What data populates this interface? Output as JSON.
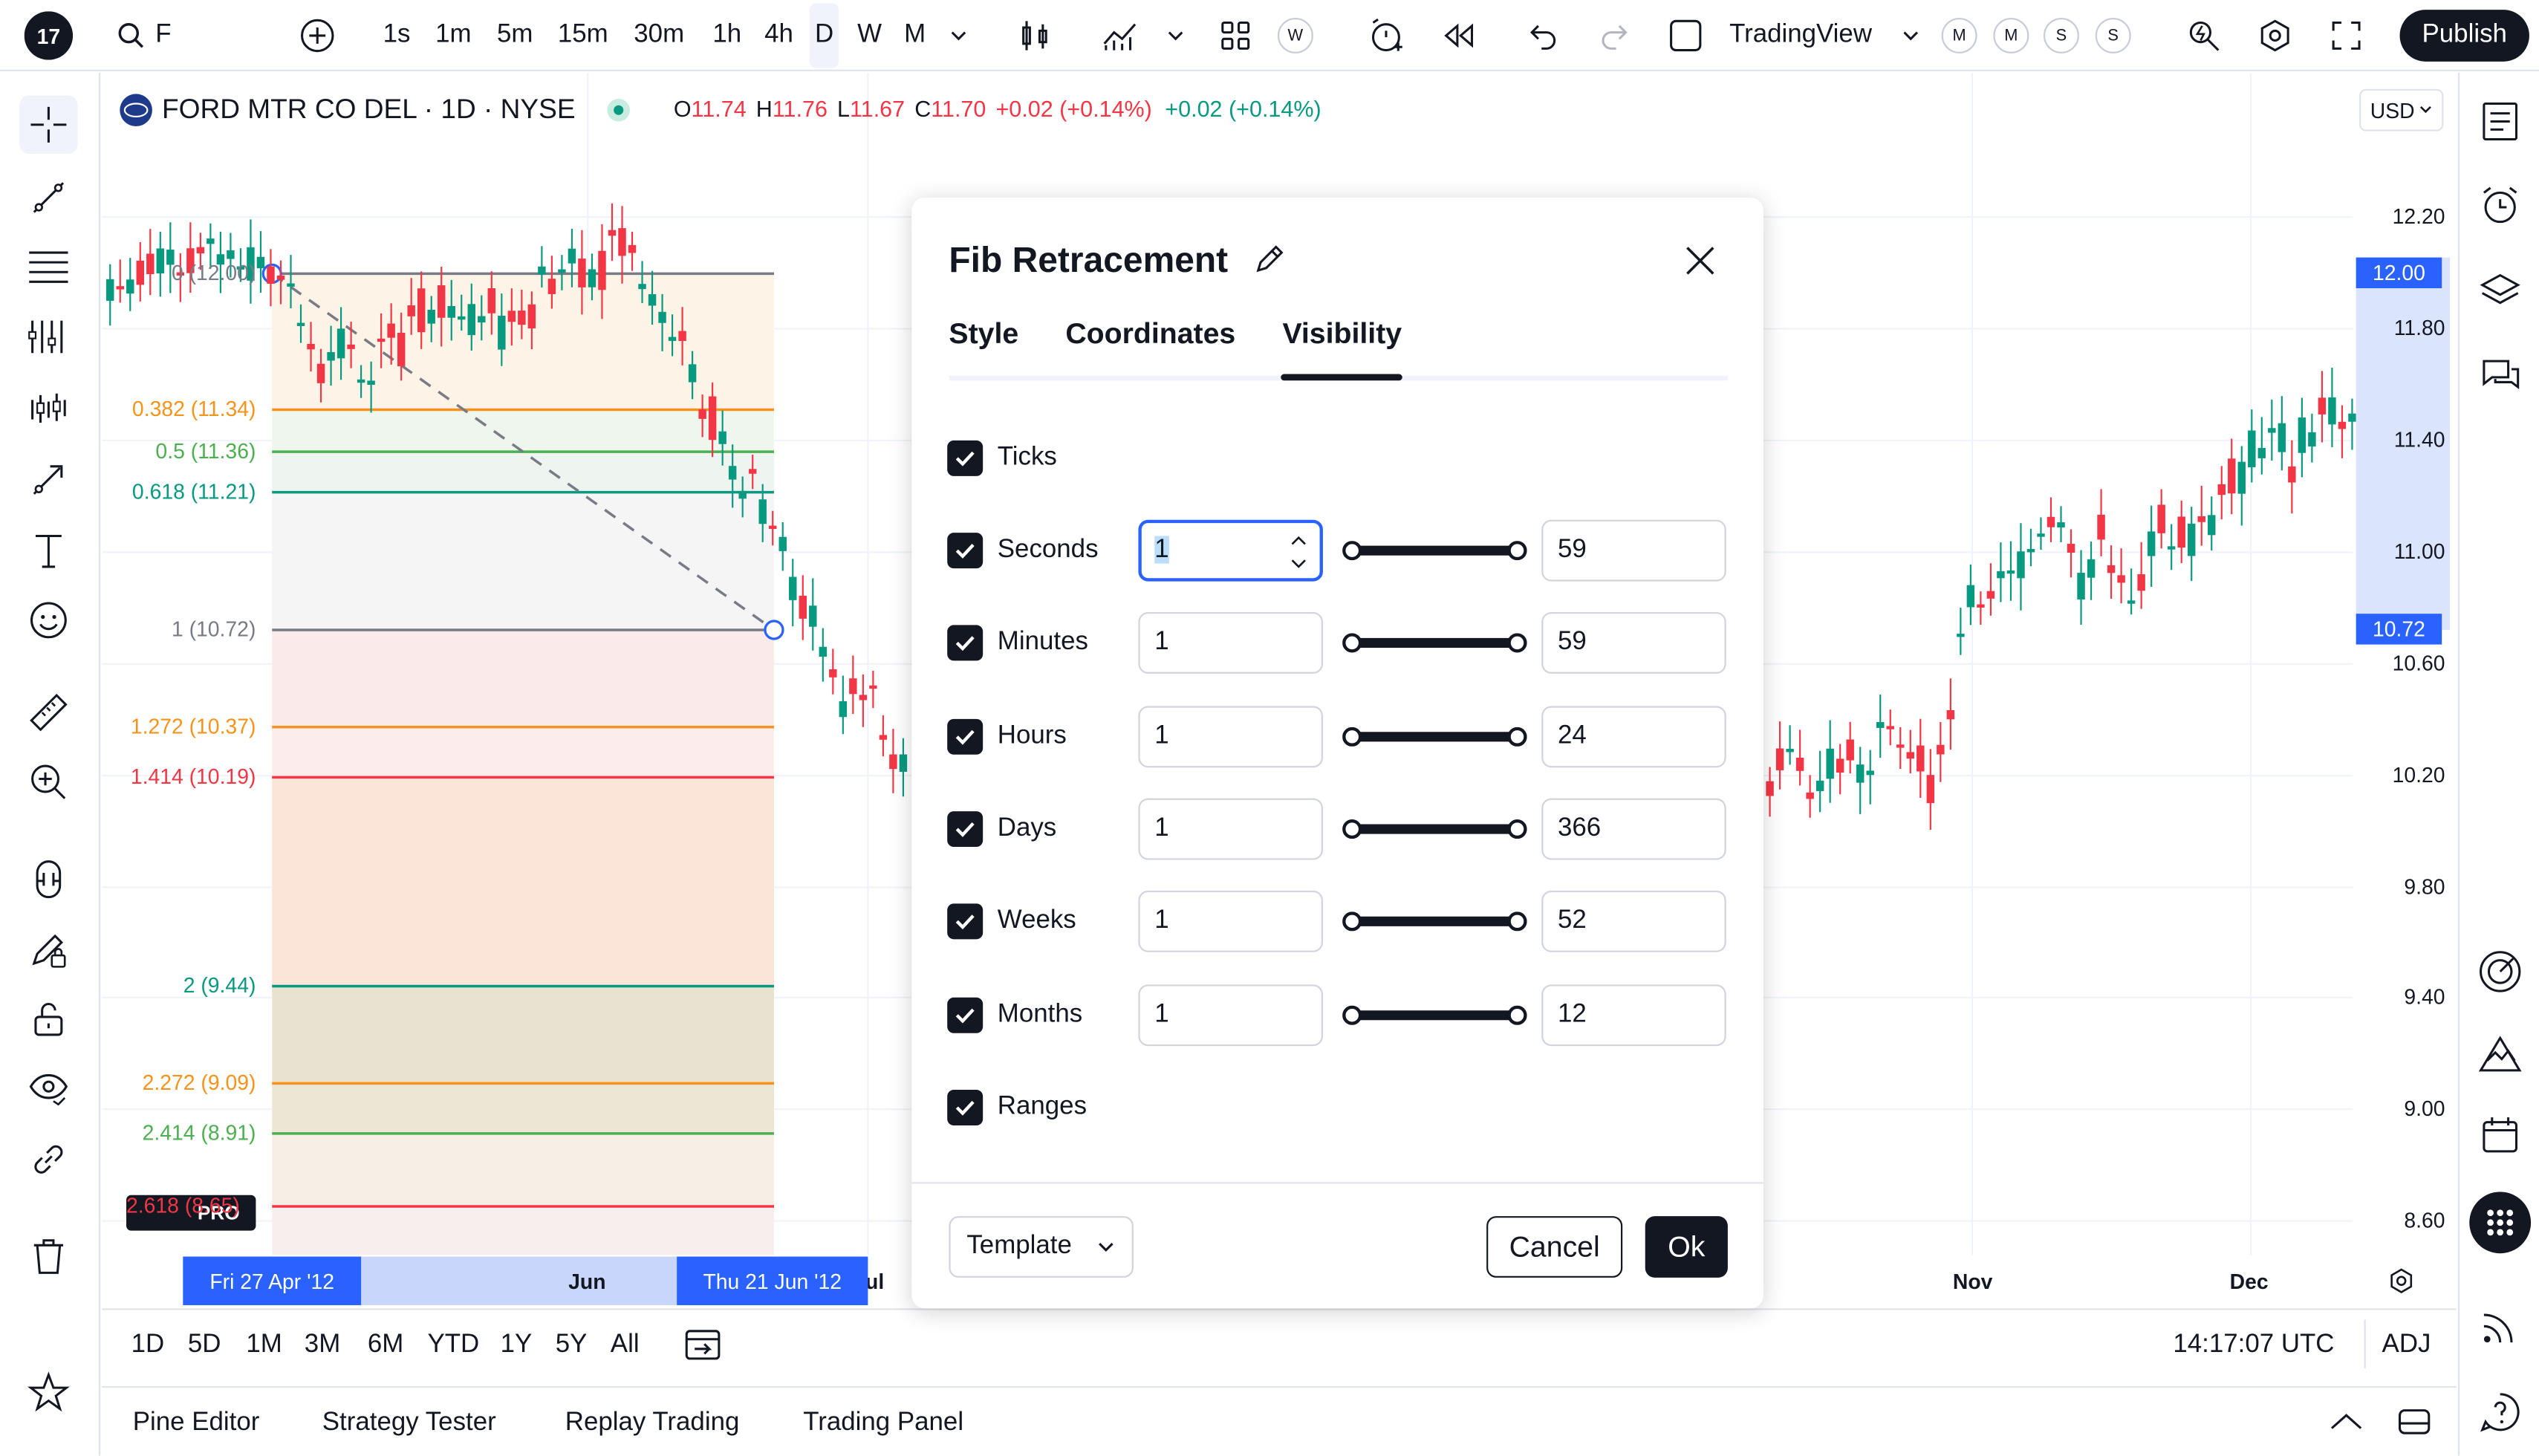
{
  "toolbar": {
    "symbol": "F",
    "intervals": [
      "1s",
      "1m",
      "5m",
      "15m",
      "30m",
      "1h",
      "4h",
      "D",
      "W",
      "M"
    ],
    "active_interval": "D",
    "layout_name": "TradingView",
    "avatars": [
      "M",
      "M",
      "S",
      "S"
    ],
    "w_badge": "W",
    "publish": "Publish"
  },
  "legend": {
    "title": "FORD MTR CO DEL · 1D · NYSE",
    "o_label": "O",
    "o": "11.74",
    "h_label": "H",
    "h": "11.76",
    "l_label": "L",
    "l": "11.67",
    "c_label": "C",
    "c": "11.70",
    "chg": "+0.02 (+0.14%)",
    "chg2": "+0.02 (+0.14%)"
  },
  "currency": "USD",
  "price_axis": [
    "12.20",
    "11.80",
    "11.40",
    "11.00",
    "10.60",
    "10.20",
    "9.80",
    "9.40",
    "9.00",
    "8.60"
  ],
  "price_badges": {
    "top": "12.00",
    "bottom": "10.72"
  },
  "fib_levels": [
    {
      "label": "0 (12.00)",
      "color": "#787b86"
    },
    {
      "label": "0.382 (11.34)",
      "color": "#f7931a"
    },
    {
      "label": "0.5 (11.36)",
      "color": "#4caf50"
    },
    {
      "label": "0.618 (11.21)",
      "color": "#089981"
    },
    {
      "label": "1 (10.72)",
      "color": "#787b86"
    },
    {
      "label": "1.272 (10.37)",
      "color": "#f7931a"
    },
    {
      "label": "1.414 (10.19)",
      "color": "#f23645"
    },
    {
      "label": "2 (9.44)",
      "color": "#089981"
    },
    {
      "label": "2.272 (9.09)",
      "color": "#f7931a"
    },
    {
      "label": "2.414 (8.91)",
      "color": "#4caf50"
    },
    {
      "label": "2.618 (8.65)",
      "color": "#f23645"
    }
  ],
  "time_axis": {
    "start_badge": "Fri 27 Apr '12",
    "end_badge": "Thu 21 Jun '12",
    "labels": [
      "Jun",
      "Jul",
      "Nov",
      "Dec"
    ]
  },
  "dialog": {
    "title": "Fib Retracement",
    "tabs": [
      "Style",
      "Coordinates",
      "Visibility"
    ],
    "active_tab": "Visibility",
    "rows": [
      {
        "label": "Ticks",
        "checked": true,
        "has_range": false
      },
      {
        "label": "Seconds",
        "checked": true,
        "has_range": true,
        "min": "1",
        "max": "59"
      },
      {
        "label": "Minutes",
        "checked": true,
        "has_range": true,
        "min": "1",
        "max": "59"
      },
      {
        "label": "Hours",
        "checked": true,
        "has_range": true,
        "min": "1",
        "max": "24"
      },
      {
        "label": "Days",
        "checked": true,
        "has_range": true,
        "min": "1",
        "max": "366"
      },
      {
        "label": "Weeks",
        "checked": true,
        "has_range": true,
        "min": "1",
        "max": "52"
      },
      {
        "label": "Months",
        "checked": true,
        "has_range": true,
        "min": "1",
        "max": "12"
      },
      {
        "label": "Ranges",
        "checked": true,
        "has_range": false
      }
    ],
    "template": "Template",
    "cancel": "Cancel",
    "ok": "Ok"
  },
  "bottom_bar": {
    "ranges": [
      "1D",
      "5D",
      "1M",
      "3M",
      "6M",
      "YTD",
      "1Y",
      "5Y",
      "All"
    ],
    "time": "14:17:07 UTC",
    "adj": "ADJ"
  },
  "panels": [
    "Pine Editor",
    "Strategy Tester",
    "Replay Trading",
    "Trading Panel"
  ],
  "watermark": "PRO",
  "colors": {
    "up": "#089981",
    "down": "#f23645",
    "accent": "#2962ff",
    "badge": "#2962ff"
  }
}
